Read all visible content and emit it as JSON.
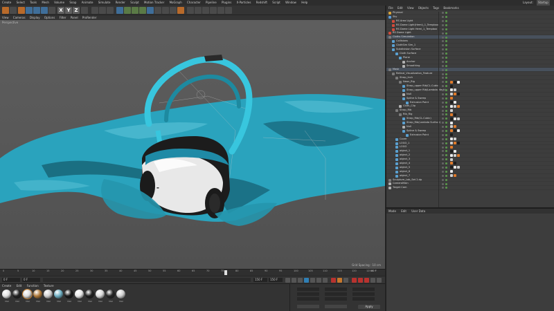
{
  "menu": {
    "items": [
      "Create",
      "Select",
      "Tools",
      "Mesh",
      "Volume",
      "Snap",
      "Animate",
      "Simulate",
      "Render",
      "Sculpt",
      "Motion Tracker",
      "MoGraph",
      "Character",
      "Pipeline",
      "Plugins",
      "X-Particles",
      "Redshift",
      "Script",
      "Window",
      "Help"
    ],
    "layout_label": "Layout:",
    "layout_value": "Startup"
  },
  "toolbar": {
    "axis_letters": [
      "X",
      "Y",
      "Z"
    ]
  },
  "viewport": {
    "menu": [
      "View",
      "Cameras",
      "Display",
      "Options",
      "Filter",
      "Panel",
      "ProRender"
    ],
    "camera_label": "Perspective",
    "grid_spacing": "Grid Spacing : 10 cm",
    "colors": {
      "cloth": "#2aa3bd",
      "cloth_dark": "#14586a",
      "strap": "#38c6de",
      "shell": "#e8e8e8",
      "frame": "#1c1c1c"
    }
  },
  "timeline": {
    "ticks": [
      "0",
      "5",
      "10",
      "15",
      "20",
      "25",
      "30",
      "35",
      "40",
      "45",
      "50",
      "55",
      "60",
      "65",
      "70",
      "75",
      "80",
      "85",
      "90",
      "95",
      "100",
      "105",
      "110",
      "115",
      "120",
      "125"
    ],
    "current_frame": "80 F",
    "start_field": "0 F",
    "start_field_2": "0 F",
    "end_field": "150 F",
    "end_field_2": "150 F"
  },
  "materials": {
    "menu": [
      "Create",
      "Edit",
      "Function",
      "Texture"
    ],
    "items": [
      {
        "label": "Mat",
        "color": "#e0e0e0"
      },
      {
        "label": "Mat",
        "color": "#222222"
      },
      {
        "label": "Mat",
        "color": "#dcdcdc"
      },
      {
        "label": "Mat",
        "color": "#b07a3a"
      },
      {
        "label": "Mat",
        "color": "#cfcfcf"
      },
      {
        "label": "Mat",
        "color": "#6fb0c4"
      },
      {
        "label": "Mat",
        "color": "#1a1a1a"
      },
      {
        "label": "Mat",
        "color": "#e6e6e6"
      },
      {
        "label": "Mat",
        "color": "#202020"
      },
      {
        "label": "Mat",
        "color": "#d8d8d8"
      },
      {
        "label": "Mat",
        "color": "#262626"
      },
      {
        "label": "Mat",
        "color": "#cfcfcf"
      }
    ]
  },
  "coords": {
    "apply_label": "Apply"
  },
  "object_manager": {
    "menu": [
      "File",
      "Edit",
      "View",
      "Objects",
      "Tags",
      "Bookmarks"
    ],
    "rows": [
      {
        "name": "Physical",
        "indent": 0,
        "icon": "#d6a23a"
      },
      {
        "name": "Sky",
        "indent": 0,
        "icon": "#5a9ad6"
      },
      {
        "name": "RS Area Light",
        "indent": 1,
        "icon": "#d24a3a"
      },
      {
        "name": "RS Dome Light(Hemi)_1_Tempbox",
        "indent": 1,
        "icon": "#d24a3a"
      },
      {
        "name": "RS Dome Light Hemi_1_Tempbox",
        "indent": 1,
        "icon": "#d24a3a"
      },
      {
        "name": "RS Dome Light",
        "indent": 0,
        "icon": "#d24a3a"
      },
      {
        "name": "Cloths Simulation",
        "indent": 0,
        "icon": "#7a7a7a"
      },
      {
        "name": "Collisions",
        "indent": 1,
        "icon": "#5aa0d0"
      },
      {
        "name": "ClothSim Sim_1",
        "indent": 1,
        "icon": "#5aa0d0"
      },
      {
        "name": "Subdivision Surface",
        "indent": 1,
        "icon": "#5aa0d0"
      },
      {
        "name": "Cloth Surface",
        "indent": 2,
        "icon": "#5aa0d0"
      },
      {
        "name": "Plane",
        "indent": 3,
        "icon": "#5aa0d0"
      },
      {
        "name": "Anchor",
        "indent": 4,
        "icon": "#b0b0b0"
      },
      {
        "name": "Smoothing",
        "indent": 4,
        "icon": "#b0b0b0"
      },
      {
        "name": "Mask",
        "indent": 0,
        "icon": "#7a7a7a"
      },
      {
        "name": "Retinal_Visualization_Feature",
        "indent": 1,
        "icon": "#7a7a7a"
      },
      {
        "name": "Strap_Inch",
        "indent": 2,
        "icon": "#7a7a7a"
      },
      {
        "name": "Neon_Rig",
        "indent": 3,
        "icon": "#7a7a7a"
      },
      {
        "name": "Strap_upper Rib(CL.Cubic)",
        "indent": 4,
        "icon": "#5aa0d0"
      },
      {
        "name": "Strap_upper Rib(Lambda Mesh)",
        "indent": 4,
        "icon": "#5aa0d0"
      },
      {
        "name": "Null",
        "indent": 4,
        "icon": "#b0b0b0"
      },
      {
        "name": "Spline & Sweep",
        "indent": 4,
        "icon": "#5aa0d0"
      },
      {
        "name": "Extrusion Point",
        "indent": 5,
        "icon": "#5aa0d0"
      },
      {
        "name": "Cloth_Clip",
        "indent": 3,
        "icon": "#b0b0b0"
      },
      {
        "name": "Strap_Rib",
        "indent": 2,
        "icon": "#7a7a7a"
      },
      {
        "name": "Rib_Rig",
        "indent": 3,
        "icon": "#7a7a7a"
      },
      {
        "name": "Strap_Rib(CL.Cubic)",
        "indent": 4,
        "icon": "#5aa0d0"
      },
      {
        "name": "Strap_Rib(Lambda Surface)",
        "indent": 4,
        "icon": "#5aa0d0"
      },
      {
        "name": "Null",
        "indent": 4,
        "icon": "#b0b0b0"
      },
      {
        "name": "Spline & Sweep",
        "indent": 4,
        "icon": "#5aa0d0"
      },
      {
        "name": "Extrusion Point",
        "indent": 5,
        "icon": "#5aa0d0"
      },
      {
        "name": "Cover",
        "indent": 2,
        "icon": "#5aa0d0"
      },
      {
        "name": "LOGO_1",
        "indent": 2,
        "icon": "#5aa0d0"
      },
      {
        "name": "LOGO",
        "indent": 2,
        "icon": "#5aa0d0"
      },
      {
        "name": "object_1",
        "indent": 2,
        "icon": "#5aa0d0"
      },
      {
        "name": "object_2",
        "indent": 2,
        "icon": "#5aa0d0"
      },
      {
        "name": "object_3",
        "indent": 2,
        "icon": "#5aa0d0"
      },
      {
        "name": "object_4",
        "indent": 2,
        "icon": "#5aa0d0"
      },
      {
        "name": "object_5",
        "indent": 2,
        "icon": "#5aa0d0"
      },
      {
        "name": "object_6",
        "indent": 2,
        "icon": "#5aa0d0"
      },
      {
        "name": "object_7",
        "indent": 2,
        "icon": "#5aa0d0"
      },
      {
        "name": "Sculpture_Lab_Set 2.dp",
        "indent": 0,
        "icon": "#7a7a7a"
      },
      {
        "name": "CameraMain",
        "indent": 0,
        "icon": "#b0b0b0"
      },
      {
        "name": "Target Cam",
        "indent": 0,
        "icon": "#b0b0b0"
      }
    ]
  },
  "attribute_manager": {
    "menu": [
      "Mode",
      "Edit",
      "User Data"
    ]
  }
}
